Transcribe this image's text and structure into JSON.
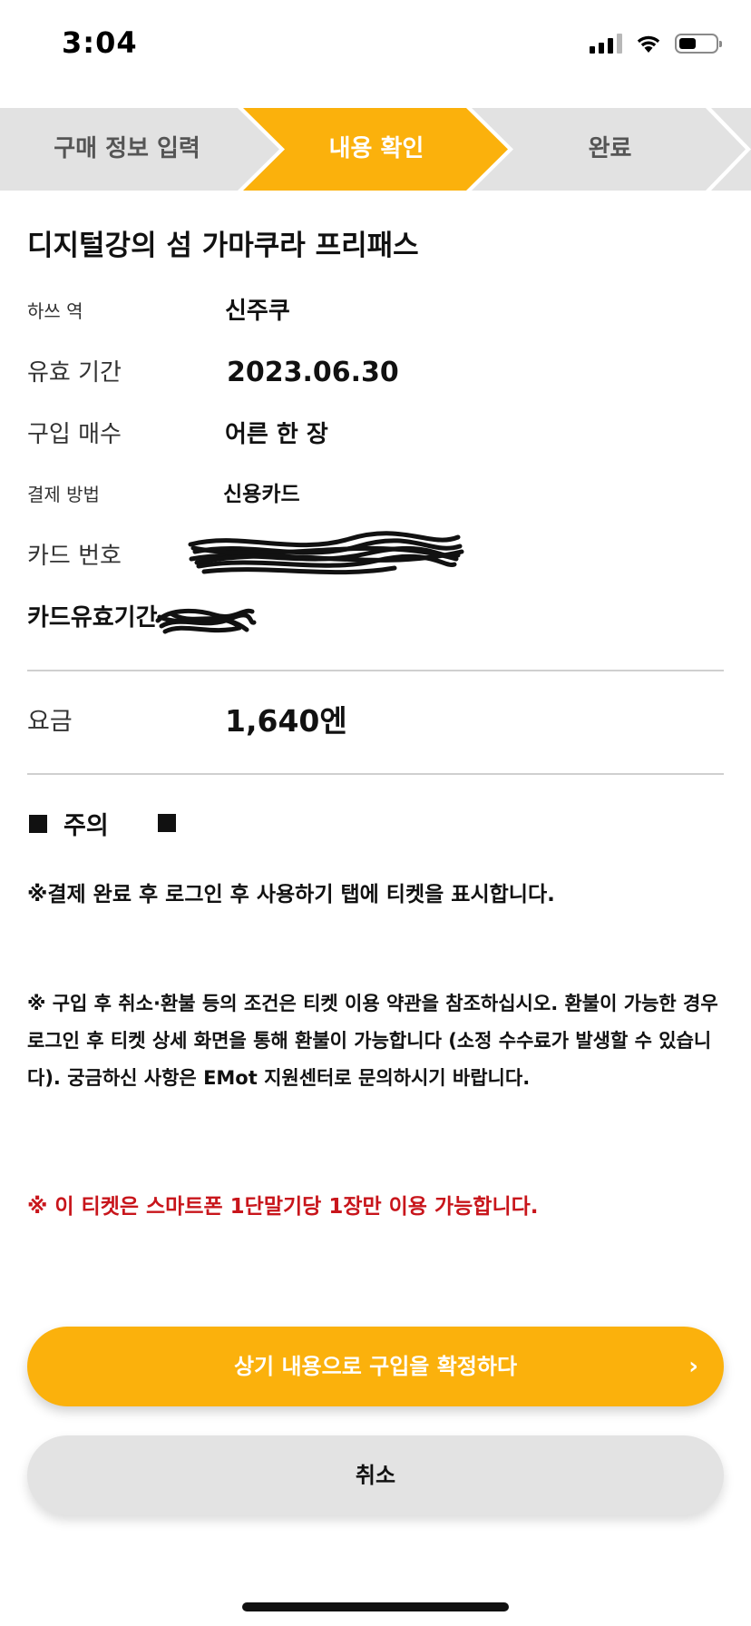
{
  "status_bar": {
    "time": "3:04",
    "icons": [
      "signal-icon",
      "wifi-icon",
      "battery-icon"
    ]
  },
  "stepper": {
    "steps": [
      {
        "label": "구매 정보 입력",
        "state": "done"
      },
      {
        "label": "내용 확인",
        "state": "active"
      },
      {
        "label": "완료",
        "state": "pending"
      }
    ],
    "active_color": "#fbb10c",
    "inactive_color": "#e2e2e2"
  },
  "ticket": {
    "title": "디지털강의 섬 가마쿠라 프리패스",
    "rows": [
      {
        "label": "하쓰 역",
        "value": "신주쿠"
      },
      {
        "label": "유효 기간",
        "value": "2023.06.30"
      },
      {
        "label": "구입 매수",
        "value": "어른 한 장"
      },
      {
        "label": "결제 방법",
        "value": "신용카드"
      },
      {
        "label": "카드 번호",
        "value": ""
      },
      {
        "label": "카드유효기간",
        "value": ""
      }
    ],
    "fare_label": "요금",
    "fare_value": "1,640엔"
  },
  "notice": {
    "heading": "주의",
    "text_1": "※결제 완료 후 로그인 후 사용하기 탭에 티켓을 표시합니다.",
    "text_2": "※ 구입 후 취소·환불 등의 조건은 티켓 이용 약관을 참조하십시오. 환불이 가능한 경우 로그인 후 티켓 상세 화면을 통해 환불이 가능합니다 (소정 수수료가 발생할 수 있습니다). 궁금하신 사항은 EMot 지원센터로 문의하시기 바랍니다.",
    "text_3": "※ 이 티켓은 스마트폰 1단말기당 1장만 이용 가능합니다.",
    "warning_color": "#c8151b"
  },
  "buttons": {
    "confirm_label": "상기 내용으로 구입을 확정하다",
    "confirm_chevron": "›",
    "cancel_label": "취소",
    "confirm_color": "#fbb10c",
    "cancel_color": "#e3e3e3"
  }
}
